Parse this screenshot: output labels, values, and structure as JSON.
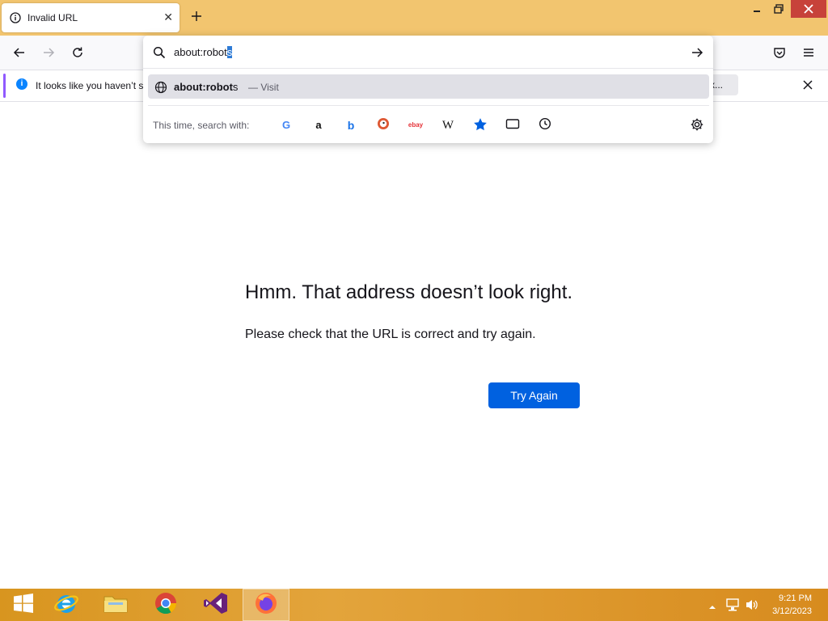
{
  "browser": {
    "tab": {
      "title": "Invalid URL"
    },
    "urlbar": {
      "typed": "about:robot",
      "selected": "s"
    },
    "suggestion": {
      "bold": "about:robot",
      "rest": "s",
      "action": "— Visit"
    },
    "oneoff": {
      "label": "This time, search with:",
      "engines": [
        "google-icon",
        "amazon-icon",
        "bing-icon",
        "duckduckgo-icon",
        "ebay-icon",
        "wikipedia-icon",
        "bookmarks-icon",
        "tabs-icon",
        "history-icon"
      ]
    },
    "notification": {
      "message": "It looks like you haven’t s",
      "button_label": "x..."
    }
  },
  "page": {
    "title": "Hmm. That address doesn’t look right.",
    "description": "Please check that the URL is correct and try again.",
    "button": "Try Again"
  },
  "taskbar": {
    "time": "9:21 PM",
    "date": "3/12/2023"
  },
  "colors": {
    "titlebar": "#f2c56f",
    "accent_button": "#0061e0",
    "taskbar": "#d8951f"
  }
}
